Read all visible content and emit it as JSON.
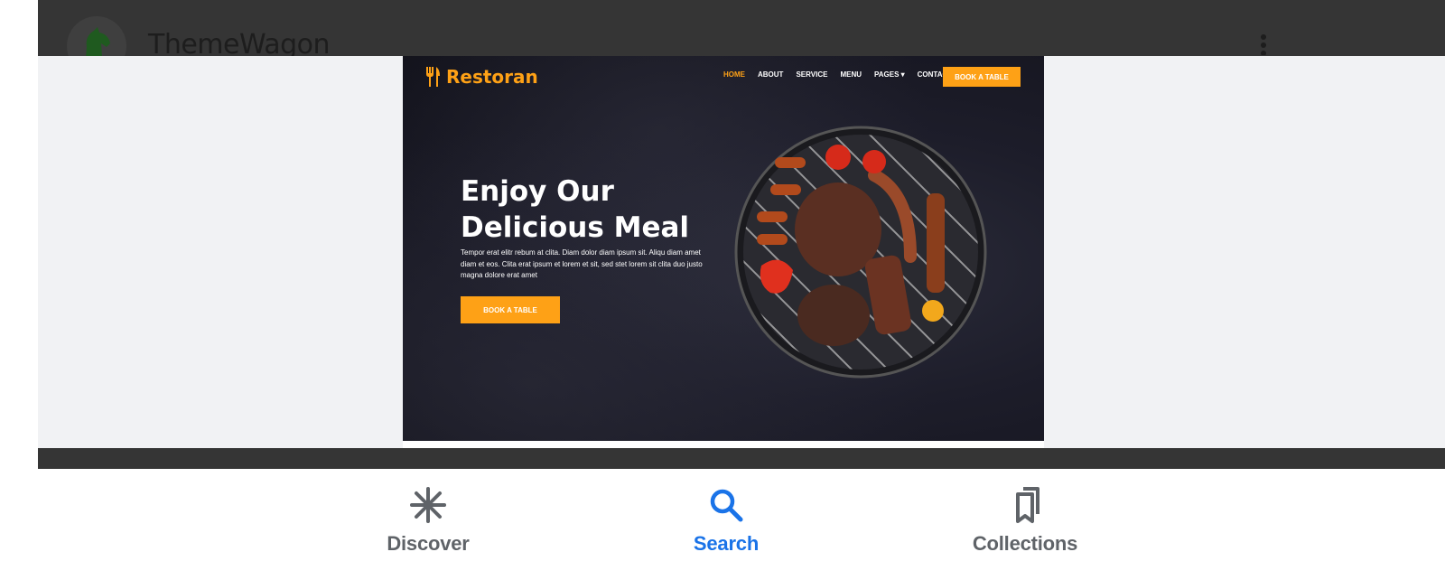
{
  "source": {
    "name": "ThemeWagon",
    "avatar_icon": "horse-logo-icon",
    "menu_icon": "more-vertical-icon"
  },
  "preview_site": {
    "logo_text": "Restoran",
    "logo_icon": "utensils-icon",
    "nav": [
      {
        "label": "HOME",
        "active": true
      },
      {
        "label": "ABOUT"
      },
      {
        "label": "SERVICE"
      },
      {
        "label": "MENU"
      },
      {
        "label": "PAGES ▾"
      },
      {
        "label": "CONTACT"
      }
    ],
    "top_cta": "BOOK A TABLE",
    "hero_title_line1": "Enjoy Our",
    "hero_title_line2": "Delicious Meal",
    "hero_text": "Tempor erat elitr rebum at clita. Diam dolor diam ipsum sit. Aliqu diam amet diam et eos. Clita erat ipsum et lorem et sit, sed stet lorem sit clita duo justo magna dolore erat amet",
    "hero_button": "BOOK A TABLE",
    "accent_color": "#FEA116"
  },
  "bottom_nav": {
    "items": [
      {
        "label": "Discover",
        "icon": "asterisk-icon",
        "active": false
      },
      {
        "label": "Search",
        "icon": "search-icon",
        "active": true
      },
      {
        "label": "Collections",
        "icon": "bookmarks-icon",
        "active": false
      }
    ],
    "active_color": "#1a73e8",
    "inactive_color": "#5f6368"
  }
}
